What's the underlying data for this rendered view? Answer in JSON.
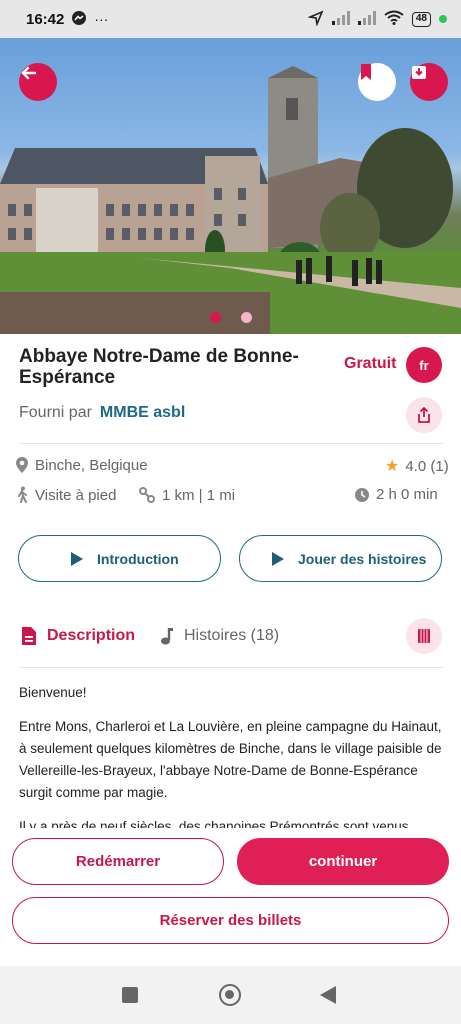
{
  "status_bar": {
    "time": "16:42",
    "dots": "···",
    "battery": "48"
  },
  "hero": {
    "buttons": {
      "back": "back-arrow-icon",
      "bookmark": "bookmark-icon",
      "download": "download-icon"
    },
    "carousel_active_index": 0,
    "carousel_count": 2
  },
  "tour": {
    "title": "Abbaye Notre-Dame de Bonne-Espérance",
    "price": "Gratuit",
    "language": "fr",
    "provided_by_label": "Fourni par",
    "provider": "MMBE asbl",
    "location": "Binche, Belgique",
    "rating": "4.0 (1)",
    "mode": "Visite à pied",
    "distance": "1 km | 1 mi",
    "duration": "2 h 0 min"
  },
  "actions": {
    "intro": "Introduction",
    "play": "Jouer des histoires"
  },
  "tabs": {
    "description": "Description",
    "stories": "Histoires (18)"
  },
  "description": {
    "p1": "Bienvenue!",
    "p2": "Entre Mons, Charleroi et La Louvière, en pleine campagne du Hainaut, à seulement quelques kilomètres de Binche, dans le village paisible de Vellereille-les-Brayeux, l'abbaye Notre-Dame de Bonne-Espérance surgit comme par magie.",
    "p3": "Il y a près de neuf siècles, des chanoines Prémontrés sont venus"
  },
  "bottom": {
    "restart": "Redémarrer",
    "continue": "continuer",
    "tickets": "Réserver des billets"
  },
  "colors": {
    "accent": "#d8174f",
    "link": "#1e6a86",
    "star": "#f0a030"
  }
}
